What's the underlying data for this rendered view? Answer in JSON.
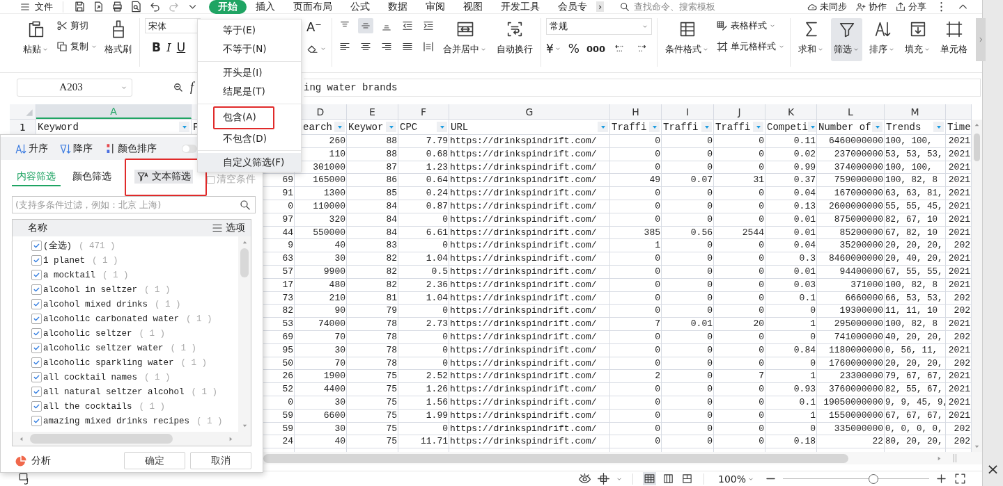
{
  "top_bar": {
    "file_menu": "文件",
    "tabs": [
      {
        "label": "开始",
        "selected": true
      },
      {
        "label": "插入",
        "selected": false
      },
      {
        "label": "页面布局",
        "selected": false
      },
      {
        "label": "公式",
        "selected": false
      },
      {
        "label": "数据",
        "selected": false
      },
      {
        "label": "审阅",
        "selected": false
      },
      {
        "label": "视图",
        "selected": false
      },
      {
        "label": "开发工具",
        "selected": false
      },
      {
        "label": "会员专",
        "selected": false
      }
    ],
    "more": "›",
    "search": {
      "placeholder": "查找命令、搜索模板"
    },
    "actions": [
      "未同步",
      "协作",
      "分享"
    ]
  },
  "ribbon": {
    "paste": "粘贴",
    "cut": "剪切",
    "copy": "复制",
    "format_painter": "格式刷",
    "font": "宋体",
    "bold": "B",
    "italic": "I",
    "underline": "U",
    "font_shrink": "A⁻",
    "merge": "合并居中",
    "wrap": "自动换行",
    "number_format": "常规",
    "currency": "¥",
    "percent": "%",
    "thousands": "000",
    "conditional": "条件格式",
    "table_style": "表格样式",
    "cell_style": "单元格样式",
    "sum": "求和",
    "filter": {
      "label": "筛选",
      "active": true
    },
    "sort": "排序",
    "fill": "填充",
    "cell": "单元格"
  },
  "formula_bar": {
    "name_box": "A203",
    "fx": "f",
    "content": "ing water brands"
  },
  "sheet": {
    "columns": [
      {
        "label": "A",
        "selected": true
      },
      null,
      null,
      {
        "label": "D",
        "selected": false
      },
      {
        "label": "E",
        "selected": false
      },
      {
        "label": "F",
        "selected": false
      },
      {
        "label": "G",
        "selected": false
      },
      {
        "label": "H",
        "selected": false
      },
      {
        "label": "I",
        "selected": false
      },
      {
        "label": "J",
        "selected": false
      },
      {
        "label": "K",
        "selected": false
      },
      {
        "label": "L",
        "selected": false
      },
      {
        "label": "M",
        "selected": false
      },
      null
    ],
    "header_row": {
      "number": "1",
      "cells": [
        {
          "text": "Keyword",
          "filter": true
        },
        {
          "text": "F"
        },
        null,
        {
          "text": "earch",
          "filter": true
        },
        {
          "text": "Keywor",
          "filter": true
        },
        {
          "text": "CPC",
          "filter": true
        },
        {
          "text": "URL",
          "filter": true
        },
        {
          "text": "Traffi",
          "filter": true
        },
        {
          "text": "Traffi",
          "filter": true
        },
        {
          "text": "Traffi",
          "filter": true
        },
        {
          "text": "Competi",
          "filter": true
        },
        {
          "text": "Number of",
          "filter": true
        },
        {
          "text": "Trends",
          "filter": true
        },
        {
          "text": "Time"
        }
      ]
    },
    "rows": [
      {
        "cells": [
          null,
          null,
          null,
          "260",
          "88",
          "7.79",
          "https://drinkspindrift.com/",
          "0",
          "0",
          "0",
          "0.11",
          "6460000000",
          "100, 100,",
          "2021"
        ]
      },
      {
        "cells": [
          null,
          null,
          null,
          "110",
          "88",
          "0.68",
          "https://drinkspindrift.com/",
          "0",
          "0",
          "0",
          "0.02",
          "237000000",
          "53, 53, 53,",
          "2021"
        ]
      },
      {
        "cells": [
          null,
          null,
          null,
          "301000",
          "87",
          "1.23",
          "https://drinkspindrift.com/",
          "0",
          "0",
          "0",
          "0.99",
          "374000000",
          "100, 100,",
          "2021"
        ]
      },
      {
        "cells": [
          null,
          null,
          "69",
          "165000",
          "86",
          "0.64",
          "https://drinkspindrift.com/",
          "49",
          "0.07",
          "31",
          "0.37",
          "759000000",
          "100, 82, 8",
          "2021"
        ]
      },
      {
        "cells": [
          null,
          null,
          "91",
          "1300",
          "85",
          "0.24",
          "https://drinkspindrift.com/",
          "0",
          "0",
          "0",
          "0.04",
          "167000000",
          "63, 63, 81,",
          "2021"
        ]
      },
      {
        "cells": [
          null,
          null,
          "0",
          "110000",
          "84",
          "0.87",
          "https://drinkspindrift.com/",
          "0",
          "0",
          "0",
          "0.13",
          "2600000000",
          "55, 55, 45,",
          "2021"
        ]
      },
      {
        "cells": [
          null,
          null,
          "97",
          "320",
          "84",
          "0",
          "https://drinkspindrift.com/",
          "0",
          "0",
          "0",
          "0.01",
          "875000000",
          "82, 67, 10",
          "2021"
        ]
      },
      {
        "cells": [
          null,
          null,
          "44",
          "550000",
          "84",
          "6.61",
          "https://drinkspindrift.com/",
          "385",
          "0.56",
          "2544",
          "0.01",
          "85200000",
          "67, 82, 10",
          "2021"
        ]
      },
      {
        "cells": [
          null,
          null,
          "9",
          "40",
          "83",
          "0",
          "https://drinkspindrift.com/",
          "1",
          "0",
          "0",
          "0.04",
          "35200000",
          "20, 20, 20,",
          "202"
        ]
      },
      {
        "cells": [
          null,
          null,
          "63",
          "30",
          "82",
          "1.04",
          "https://drinkspindrift.com/",
          "0",
          "0",
          "0",
          "0.3",
          "8460000000",
          "20, 40, 20,",
          "2021"
        ]
      },
      {
        "cells": [
          null,
          null,
          "57",
          "9900",
          "82",
          "0.5",
          "https://drinkspindrift.com/",
          "0",
          "0",
          "0",
          "0.01",
          "94400000",
          "67, 55, 55,",
          "2021"
        ]
      },
      {
        "cells": [
          null,
          null,
          "17",
          "480",
          "82",
          "2.36",
          "https://drinkspindrift.com/",
          "0",
          "0",
          "0",
          "0.03",
          "371000",
          "100, 82, 8",
          "2021"
        ]
      },
      {
        "cells": [
          null,
          null,
          "73",
          "210",
          "81",
          "1.04",
          "https://drinkspindrift.com/",
          "0",
          "0",
          "0",
          "0.1",
          "6660000",
          "66, 53, 53,",
          "202"
        ]
      },
      {
        "cells": [
          null,
          null,
          "82",
          "90",
          "79",
          "0",
          "https://drinkspindrift.com/",
          "0",
          "0",
          "0",
          "0",
          "19300000",
          "11, 11, 10",
          "202"
        ]
      },
      {
        "cells": [
          null,
          null,
          "53",
          "74000",
          "78",
          "2.73",
          "https://drinkspindrift.com/",
          "7",
          "0.01",
          "20",
          "1",
          "295000000",
          "100, 82, 8",
          "2021"
        ]
      },
      {
        "cells": [
          null,
          null,
          "69",
          "70",
          "78",
          "0",
          "https://drinkspindrift.com/",
          "0",
          "0",
          "0",
          "0",
          "741000000",
          "40, 20, 20,",
          "202"
        ]
      },
      {
        "cells": [
          null,
          null,
          "95",
          "30",
          "78",
          "0",
          "https://drinkspindrift.com/",
          "0",
          "0",
          "0",
          "0.84",
          "1180000000",
          "0, 56, 11,",
          "2021"
        ]
      },
      {
        "cells": [
          null,
          null,
          "50",
          "70",
          "78",
          "0",
          "https://drinkspindrift.com/",
          "0",
          "0",
          "0",
          "0",
          "1760000000",
          "20, 20, 20,",
          "202"
        ]
      },
      {
        "cells": [
          null,
          null,
          "26",
          "1900",
          "75",
          "2.52",
          "https://drinkspindrift.com/",
          "2",
          "0",
          "7",
          "1",
          "23300000",
          "79, 67, 67,",
          "2021"
        ]
      },
      {
        "cells": [
          null,
          null,
          "52",
          "4400",
          "75",
          "1.26",
          "https://drinkspindrift.com/",
          "0",
          "0",
          "0",
          "0.93",
          "3760000000",
          "82, 55, 67,",
          "2021"
        ]
      },
      {
        "cells": [
          null,
          null,
          "0",
          "30",
          "75",
          "1.56",
          "https://drinkspindrift.com/",
          "0",
          "0",
          "0",
          "0.1",
          "19050000000",
          "9, 9, 45, 9,",
          "2021"
        ]
      },
      {
        "cells": [
          null,
          null,
          "59",
          "6600",
          "75",
          "1.99",
          "https://drinkspindrift.com/",
          "0",
          "0",
          "0",
          "1",
          "1550000000",
          "67, 67, 67,",
          "2021"
        ]
      },
      {
        "cells": [
          null,
          null,
          "59",
          "30",
          "75",
          "0",
          "https://drinkspindrift.com/",
          "0",
          "0",
          "0",
          "0",
          "335000000",
          "0, 0, 0, 0,",
          "202"
        ]
      },
      {
        "cells": [
          null,
          null,
          "24",
          "40",
          "75",
          "11.71",
          "https://drinkspindrift.com/",
          "0",
          "0",
          "0",
          "0.18",
          "22",
          "80, 20, 20,",
          "202"
        ]
      }
    ]
  },
  "filter_panel": {
    "sort": [
      "升序",
      "降序",
      "颜色排序"
    ],
    "toggle_on": false,
    "tabs": [
      {
        "label": "内容筛选",
        "selected": true,
        "open": false,
        "annotated": false
      },
      {
        "label": "颜色筛选",
        "selected": false,
        "open": false,
        "annotated": false
      },
      {
        "label": "文本筛选",
        "selected": false,
        "open": true,
        "annotated": true
      }
    ],
    "clear": {
      "label": "清空条件",
      "disabled": true
    },
    "search": {
      "placeholder": "(支持多条件过滤，例如：北京 上海)"
    },
    "list_header": "名称",
    "options": "选项",
    "items": [
      {
        "label": "(全选)",
        "count": "( 471 )",
        "checked": true
      },
      {
        "label": "1 planet",
        "count": "( 1 )",
        "checked": true
      },
      {
        "label": "a mocktail",
        "count": "( 1 )",
        "checked": true
      },
      {
        "label": "alcohol in seltzer",
        "count": "( 1 )",
        "checked": true
      },
      {
        "label": "alcohol mixed drinks",
        "count": "( 1 )",
        "checked": true
      },
      {
        "label": "alcoholic carbonated water",
        "count": "( 1 )",
        "checked": true
      },
      {
        "label": "alcoholic seltzer",
        "count": "( 1 )",
        "checked": true
      },
      {
        "label": "alcoholic seltzer water",
        "count": "( 1 )",
        "checked": true
      },
      {
        "label": "alcoholic sparkling water",
        "count": "( 1 )",
        "checked": true
      },
      {
        "label": "all cocktail names",
        "count": "( 1 )",
        "checked": true
      },
      {
        "label": "all natural seltzer alcohol",
        "count": "( 1 )",
        "checked": true
      },
      {
        "label": "all the cocktails",
        "count": "( 1 )",
        "checked": true
      },
      {
        "label": "amazing mixed drinks recipes",
        "count": "( 1 )",
        "checked": true
      }
    ],
    "analysis": "分析",
    "ok": "确定",
    "cancel": "取消"
  },
  "text_filter_menu": [
    {
      "kind": "item",
      "label": "等于(E)",
      "hover": false,
      "annotated": false
    },
    {
      "kind": "item",
      "label": "不等于(N)",
      "hover": false,
      "annotated": false
    },
    {
      "kind": "separator"
    },
    {
      "kind": "item",
      "label": "开头是(I)",
      "hover": false,
      "annotated": false
    },
    {
      "kind": "item",
      "label": "结尾是(T)",
      "hover": false,
      "annotated": false
    },
    {
      "kind": "separator"
    },
    {
      "kind": "item",
      "label": "包含(A)",
      "hover": false,
      "annotated": true
    },
    {
      "kind": "item",
      "label": "不包含(D)",
      "hover": false,
      "annotated": false
    },
    {
      "kind": "separator"
    },
    {
      "kind": "item",
      "label": "自定义筛选(F)",
      "hover": true,
      "annotated": false
    }
  ],
  "status_bar": {
    "zoom": {
      "label": "100%",
      "level": 0.62
    },
    "view": [
      {
        "selected": true
      },
      {
        "selected": false
      },
      {
        "selected": false
      }
    ]
  },
  "close": "×"
}
